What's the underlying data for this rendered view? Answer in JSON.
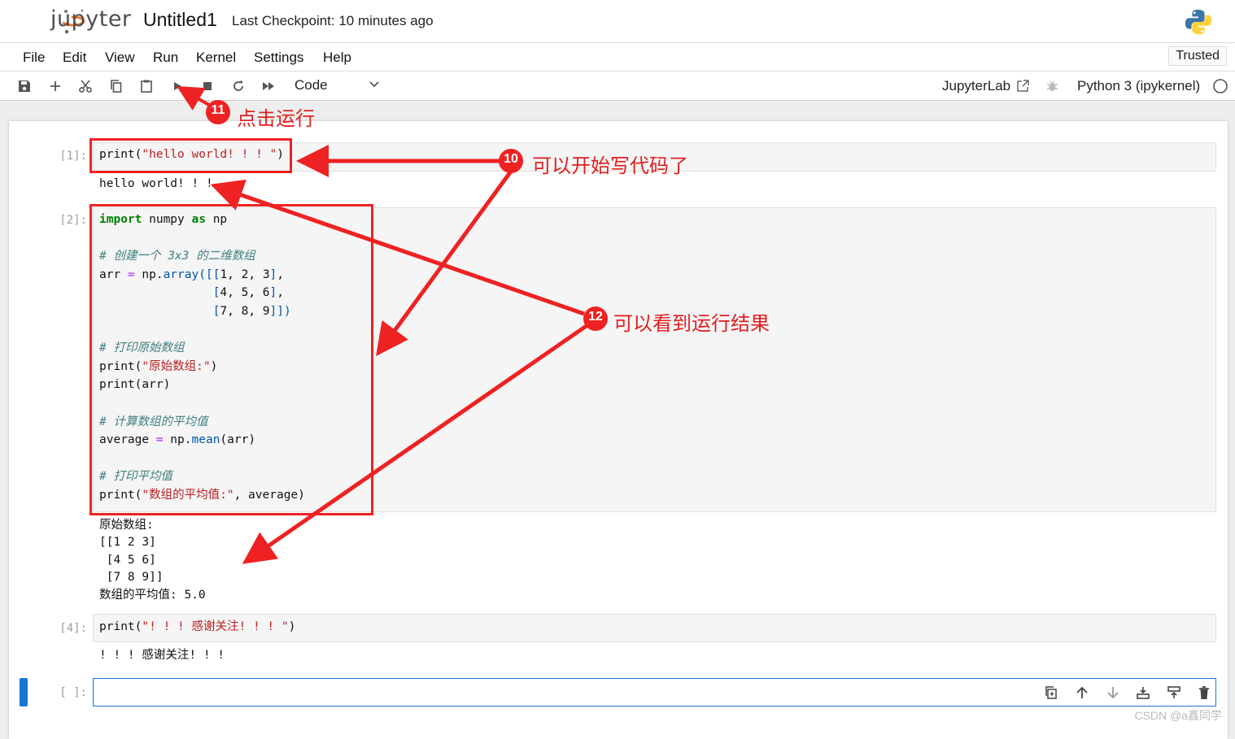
{
  "app": {
    "logo_text": "jupyter",
    "notebook_title": "Untitled1",
    "checkpoint": "Last Checkpoint: 10 minutes ago"
  },
  "menu": {
    "items": [
      "File",
      "Edit",
      "View",
      "Run",
      "Kernel",
      "Settings",
      "Help"
    ],
    "trusted": "Trusted"
  },
  "toolbar": {
    "cell_type": "Code",
    "jupyterlab_link": "JupyterLab",
    "kernel_name": "Python 3 (ipykernel)"
  },
  "cells": [
    {
      "prompt": "[1]:",
      "code_lines": [
        "print(\"hello world! ! ! \")"
      ],
      "output_lines": [
        "hello world! ! !"
      ]
    },
    {
      "prompt": "[2]:",
      "code_lines": [
        "import numpy as np",
        "",
        "# 创建一个 3x3 的二维数组",
        "arr = np.array([[1, 2, 3],",
        "                [4, 5, 6],",
        "                [7, 8, 9]])",
        "",
        "# 打印原始数组",
        "print(\"原始数组:\")",
        "print(arr)",
        "",
        "# 计算数组的平均值",
        "average = np.mean(arr)",
        "",
        "# 打印平均值",
        "print(\"数组的平均值:\", average)"
      ],
      "output_lines": [
        "原始数组:",
        "[[1 2 3]",
        " [4 5 6]",
        " [7 8 9]]",
        "数组的平均值: 5.0"
      ]
    },
    {
      "prompt": "[4]:",
      "code_lines": [
        "print(\"! ! ! 感谢关注! ! ! \")"
      ],
      "output_lines": [
        "! ! ! 感谢关注! ! !"
      ]
    },
    {
      "prompt": "[ ]:",
      "code_lines": [],
      "output_lines": []
    }
  ],
  "annotations": [
    {
      "number": "10",
      "text": "可以开始写代码了"
    },
    {
      "number": "11",
      "text": "点击运行"
    },
    {
      "number": "12",
      "text": "可以看到运行结果"
    }
  ],
  "colors": {
    "annotation": "#ee2222",
    "active_cell": "#1976d2"
  },
  "watermark": "CSDN @a鑫同学"
}
